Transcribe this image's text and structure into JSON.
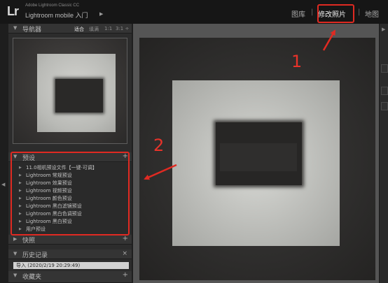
{
  "topbar": {
    "logo": "Lr",
    "brand_line1": "Adobe Lightroom Classic CC",
    "brand_line2": "Lightroom mobile 入门",
    "brand_arrow": "▶",
    "modules": [
      "图库",
      "修改照片",
      "地图"
    ],
    "module_separator": "|",
    "active_module": "修改照片"
  },
  "left_panel": {
    "navigator": {
      "title": "导航器",
      "collapse_glyph": "▼",
      "zoom_options": [
        "适合",
        "填满",
        "1:1",
        "3:1 ÷"
      ],
      "active_zoom": "适合"
    },
    "presets": {
      "title": "预设",
      "collapse_glyph": "▼",
      "add_glyph": "+",
      "items": [
        "11.0相机预设文件【一键·可调】",
        "Lightroom 常规预设",
        "Lightroom 效果预设",
        "Lightroom 视频预设",
        "Lightroom 颜色预设",
        "Lightroom 黑白滤镜预设",
        "Lightroom 黑白色调预设",
        "Lightroom 黑白预设",
        "用户预设"
      ],
      "item_glyph": "▶"
    },
    "snapshots": {
      "title": "快照",
      "collapse_glyph": "▶",
      "add_glyph": "+"
    },
    "history": {
      "title": "历史记录",
      "collapse_glyph": "▼",
      "clear_glyph": "×",
      "entries": [
        "导入 (2020/2/19 20:29:49)"
      ]
    },
    "collections": {
      "title": "收藏夹",
      "collapse_glyph": "▼",
      "add_glyph": "+"
    },
    "edge_arrow": "◀"
  },
  "right_edge": {
    "arrow": "▶"
  },
  "annotations": {
    "labels": [
      "1",
      "2"
    ],
    "color": "#e02a22"
  },
  "colors": {
    "background": "#1f1f1f",
    "panel": "#2c2c2c",
    "canvas": "#555555",
    "annotation_red": "#e02a22"
  }
}
